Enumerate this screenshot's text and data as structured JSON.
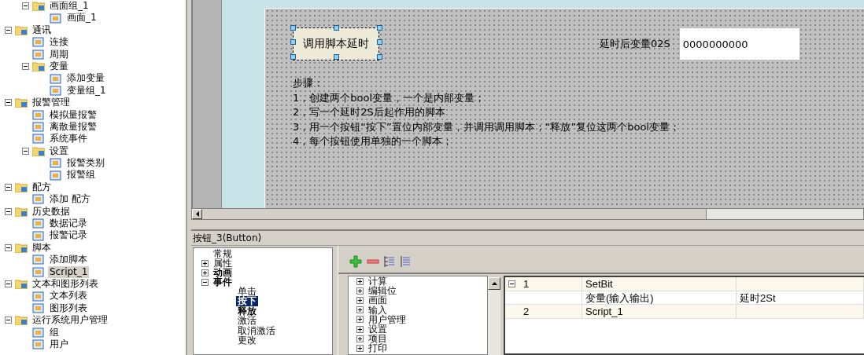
{
  "project_tree": {
    "continued_children": [
      {
        "label": "画面组_1",
        "expanded": true,
        "selected": false,
        "children": [
          {
            "label": "画面_1",
            "selected": false
          }
        ]
      }
    ],
    "items": [
      {
        "label": "通讯",
        "expanded": true,
        "selected": false,
        "children": [
          {
            "label": "连接",
            "selected": false
          },
          {
            "label": "周期",
            "selected": false
          },
          {
            "label": "变量",
            "expanded": true,
            "selected": false,
            "children": [
              {
                "label": "添加变量",
                "selected": false
              },
              {
                "label": "变量组_1",
                "selected": false
              }
            ]
          }
        ]
      },
      {
        "label": "报警管理",
        "expanded": true,
        "selected": false,
        "children": [
          {
            "label": "模拟量报警",
            "selected": false
          },
          {
            "label": "离散量报警",
            "selected": false
          },
          {
            "label": "系统事件",
            "selected": false
          },
          {
            "label": "设置",
            "expanded": true,
            "selected": false,
            "children": [
              {
                "label": "报警类别",
                "selected": false
              },
              {
                "label": "报警组",
                "selected": false
              }
            ]
          }
        ]
      },
      {
        "label": "配方",
        "expanded": true,
        "selected": false,
        "children": [
          {
            "label": "添加 配方",
            "selected": false
          }
        ]
      },
      {
        "label": "历史数据",
        "expanded": true,
        "selected": false,
        "children": [
          {
            "label": "数据记录",
            "selected": false
          },
          {
            "label": "报警记录",
            "selected": false
          }
        ]
      },
      {
        "label": "脚本",
        "expanded": true,
        "selected": false,
        "children": [
          {
            "label": "添加脚本",
            "selected": false
          },
          {
            "label": "Script_1",
            "selected": true
          }
        ]
      },
      {
        "label": "文本和图形列表",
        "expanded": true,
        "selected": false,
        "children": [
          {
            "label": "文本列表",
            "selected": false
          },
          {
            "label": "图形列表",
            "selected": false
          }
        ]
      },
      {
        "label": "运行系统用户管理",
        "expanded": true,
        "selected": false,
        "children": [
          {
            "label": "组",
            "selected": false
          },
          {
            "label": "用户",
            "selected": false
          }
        ]
      }
    ]
  },
  "canvas": {
    "button": {
      "label": "调用脚本延时",
      "selected": true
    },
    "field_label": "延时后变量02S",
    "field": {
      "value": "0000000000"
    },
    "notes": [
      "步骤：",
      "1，创建两个bool变量，一个是内部变量；",
      "2，写一个延时2S后起作用的脚本",
      "3，用一个按钮“按下”置位内部变量，并调用调用脚本；“释放”复位这两个bool变量；",
      "4，每个按钮使用单独的一个脚本；"
    ]
  },
  "properties": {
    "title": "按钮_3(Button)",
    "categories": [
      {
        "label": "常规",
        "bold": false,
        "selected": false
      },
      {
        "label": "属性",
        "bold": false,
        "selected": false,
        "expanded": false
      },
      {
        "label": "动画",
        "bold": true,
        "selected": false,
        "expanded": false
      },
      {
        "label": "事件",
        "bold": true,
        "selected": false,
        "expanded": true,
        "children": [
          {
            "label": "单击",
            "bold": false,
            "selected": false
          },
          {
            "label": "按下",
            "bold": true,
            "selected": true
          },
          {
            "label": "释放",
            "bold": true,
            "selected": false
          },
          {
            "label": "激活",
            "bold": false,
            "selected": false
          },
          {
            "label": "取消激活",
            "bold": false,
            "selected": false
          },
          {
            "label": "更改",
            "bold": false,
            "selected": false
          }
        ]
      }
    ],
    "functions": [
      {
        "label": "计算",
        "expanded": false
      },
      {
        "label": "编辑位",
        "expanded": false
      },
      {
        "label": "画面",
        "expanded": false
      },
      {
        "label": "输入",
        "expanded": false
      },
      {
        "label": "用户管理",
        "expanded": false
      },
      {
        "label": "设置",
        "expanded": false
      },
      {
        "label": "项目",
        "expanded": false
      },
      {
        "label": "打印",
        "expanded": false
      }
    ],
    "function_rows": [
      {
        "kind": "function",
        "number": "1",
        "expanded": true,
        "name": "SetBit"
      },
      {
        "kind": "parameter",
        "name": "变量(输入输出)",
        "value": "延时2St"
      },
      {
        "kind": "function",
        "number": "2",
        "name": "Script_1"
      }
    ]
  }
}
